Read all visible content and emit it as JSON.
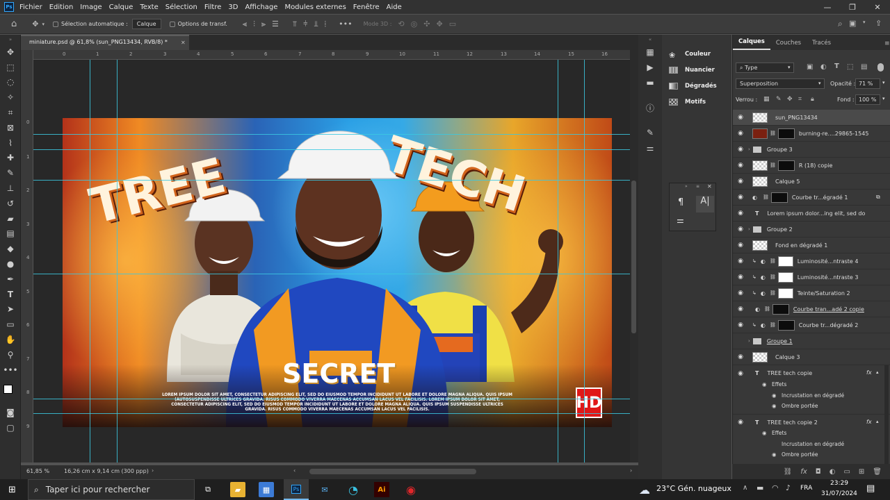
{
  "menu": [
    "Fichier",
    "Edition",
    "Image",
    "Calque",
    "Texte",
    "Sélection",
    "Filtre",
    "3D",
    "Affichage",
    "Modules externes",
    "Fenêtre",
    "Aide"
  ],
  "app_badge": "Ps",
  "options": {
    "auto_select": "Sélection automatique :",
    "auto_select_value": "Calque",
    "transform": "Options de transf.",
    "mode3d": "Mode 3D :"
  },
  "document_tab": "miniature.psd @ 61,8% (sun_PNG13434, RVB/8) *",
  "ruler_h": [
    "0",
    "1",
    "2",
    "3",
    "4",
    "5",
    "6",
    "7",
    "8",
    "9",
    "10",
    "11",
    "12",
    "13",
    "14",
    "15",
    "16"
  ],
  "ruler_v": [
    "0",
    "1",
    "2",
    "3",
    "4",
    "5",
    "6",
    "7",
    "8",
    "9"
  ],
  "artwork": {
    "word1": "TREE",
    "word2": "TECH",
    "secret": "SECRET",
    "hd": "HD",
    "lorem": "LOREM IPSUM DOLOR SIT AMET, CONSECTETUR ADIPISCING ELIT, SED DO EIUSMOD TEMPOR INCIDIDUNT UT LABORE ET DOLORE MAGNA ALIQUA. QUIS IPSUM (AUTOSUSPENDISSE ULTRICES GRAVIDA. RISUS COMMODO VIVERRA MAECENAS ACCUMSAN LACUS VEL FACILISIS. LOREM IPSUM DOLOR SIT AMET, CONSECTETUR ADIPISCING ELIT, SED DO EIUSMOD TEMPOR INCIDIDUNT UT LABORE ET DOLORE MAGNA ALIQUA. QUIS IPSUM SUSPENDISSE ULTRICES GRAVIDA. RISUS COMMODO VIVERRA MAECENAS ACCUMSAN LACUS VEL FACILISIS."
  },
  "status": {
    "zoom": "61,85 %",
    "doc_size": "16,26 cm x 9,14 cm (300 ppp)"
  },
  "mid_panel": [
    "Couleur",
    "Nuancier",
    "Dégradés",
    "Motifs"
  ],
  "layers_panel": {
    "tabs": [
      "Calques",
      "Couches",
      "Tracés"
    ],
    "filter": "Type",
    "blend": "Superposition",
    "opacity_label": "Opacité :",
    "opacity": "71 %",
    "lock_label": "Verrou :",
    "fill_label": "Fond :",
    "fill": "100 %",
    "layers": [
      "sun_PNG13434",
      "burning-re....29865-1545",
      "Groupe 3",
      "R (18) copie",
      "Calque 5",
      "Courbe tr...égradé 1",
      "Lorem ipsum dolor...ing elit, sed do",
      "Groupe 2",
      "Fond en dégradé 1",
      "Luminosité...ntraste 4",
      "Luminosité...ntraste 3",
      "Teinte/Saturation 2",
      "Courbe tran...adé 2 copie",
      "Courbe tr...dégradé 2",
      "Groupe 1",
      "Calque 3"
    ],
    "text_layers": [
      {
        "name": "TREE   tech copie",
        "effects": "Effets",
        "e1": "Incrustation en dégradé",
        "e2": "Ombre portée"
      },
      {
        "name": "TREE   tech copie 2",
        "effects": "Effets",
        "e1": "Incrustation en dégradé",
        "e2": "Ombre portée"
      }
    ],
    "fx": "fx"
  },
  "taskbar": {
    "search": "Taper ici pour rechercher",
    "weather": "23°C  Gén. nuageux",
    "lang": "FRA",
    "time": "23:29",
    "date": "31/07/2024"
  }
}
